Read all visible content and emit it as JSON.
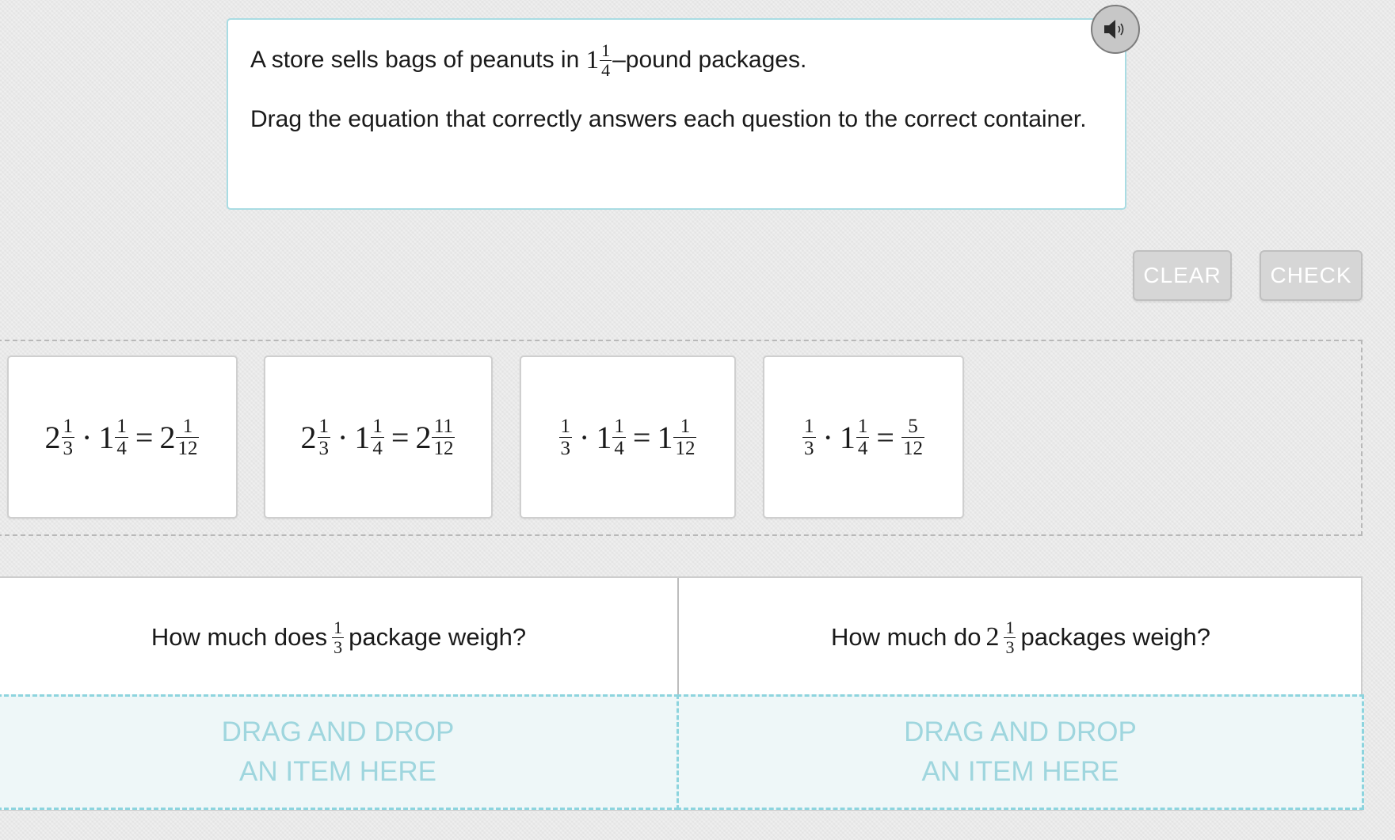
{
  "prompt": {
    "line1_before": "A store sells bags of peanuts in",
    "line1_whole": "1",
    "line1_num": "1",
    "line1_den": "4",
    "line1_after": "–pound packages.",
    "line2": "Drag the equation that correctly answers each question to the correct container."
  },
  "audio": {
    "icon": "speaker-icon"
  },
  "buttons": {
    "clear": "CLEAR",
    "check": "CHECK"
  },
  "tiles": [
    {
      "a_whole": "2",
      "a_num": "1",
      "a_den": "3",
      "dot": "·",
      "b_whole": "1",
      "b_num": "1",
      "b_den": "4",
      "eq": "=",
      "r_whole": "2",
      "r_num": "1",
      "r_den": "12"
    },
    {
      "a_whole": "2",
      "a_num": "1",
      "a_den": "3",
      "dot": "·",
      "b_whole": "1",
      "b_num": "1",
      "b_den": "4",
      "eq": "=",
      "r_whole": "2",
      "r_num": "11",
      "r_den": "12"
    },
    {
      "a_num": "1",
      "a_den": "3",
      "dot": "·",
      "b_whole": "1",
      "b_num": "1",
      "b_den": "4",
      "eq": "=",
      "r_whole": "1",
      "r_num": "1",
      "r_den": "12"
    },
    {
      "a_num": "1",
      "a_den": "3",
      "dot": "·",
      "b_whole": "1",
      "b_num": "1",
      "b_den": "4",
      "eq": "=",
      "r_num": "5",
      "r_den": "12"
    }
  ],
  "targets": [
    {
      "before": "How much does",
      "whole": "",
      "num": "1",
      "den": "3",
      "after": "package weigh?",
      "drop_line1": "DRAG AND DROP",
      "drop_line2": "AN ITEM HERE"
    },
    {
      "before": "How much do",
      "whole": "2",
      "num": "1",
      "den": "3",
      "after": "packages weigh?",
      "drop_line1": "DRAG AND DROP",
      "drop_line2": "AN ITEM HERE"
    }
  ],
  "colors": {
    "accent": "#8dd4de",
    "button": "#d6d6d6",
    "drop_bg": "#eef7f8"
  }
}
